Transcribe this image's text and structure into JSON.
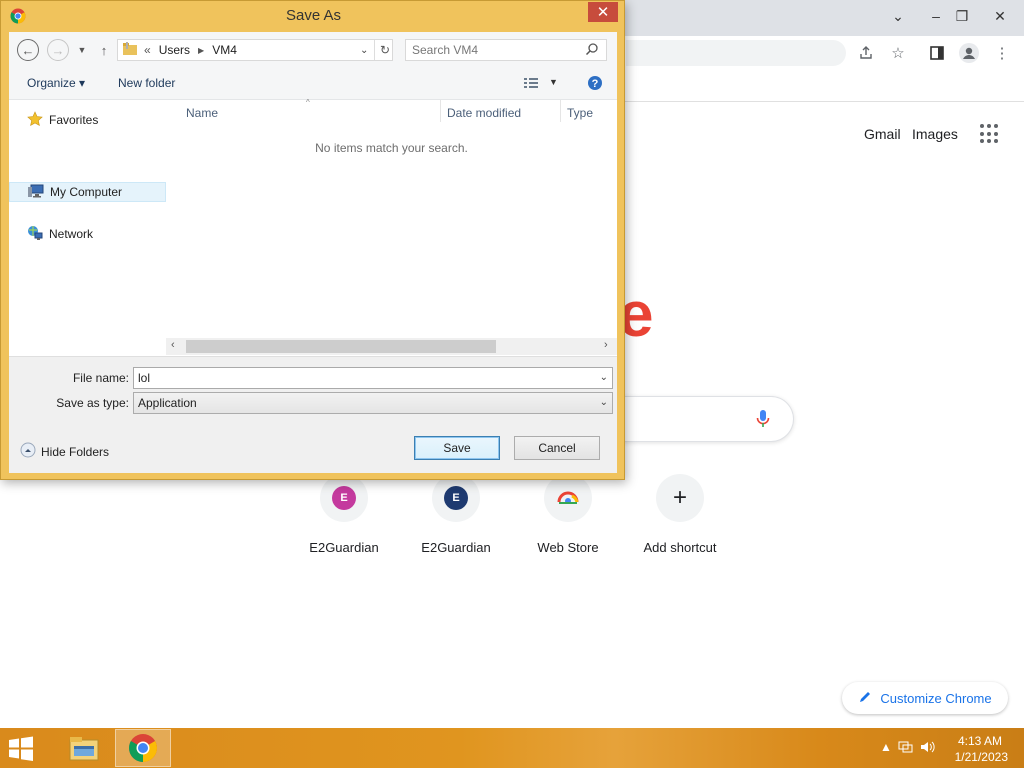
{
  "dialog": {
    "title": "Save As",
    "close_glyph": "✕",
    "address": {
      "prefix": "«",
      "path": [
        "Users",
        "VM4"
      ]
    },
    "search_placeholder": "Search VM4",
    "toolbar": {
      "organize": "Organize ▾",
      "new_folder": "New folder"
    },
    "nav": {
      "favorites": "Favorites",
      "my_computer": "My Computer",
      "network": "Network"
    },
    "columns": {
      "name": "Name",
      "date_modified": "Date modified",
      "type": "Type"
    },
    "empty_message": "No items match your search.",
    "file_name_label": "File name:",
    "file_name_value": "lol",
    "save_type_label": "Save as type:",
    "save_type_value": "Application",
    "hide_folders": "Hide Folders",
    "save_button": "Save",
    "cancel_button": "Cancel"
  },
  "browser": {
    "header_links": [
      "Gmail",
      "Images"
    ],
    "shortcuts": [
      {
        "label": "E2Guardian",
        "letter": "E",
        "color": "#c43a9e"
      },
      {
        "label": "E2Guardian",
        "letter": "E",
        "color": "#1e3a70"
      },
      {
        "label": "Web Store",
        "letter": "",
        "color": ""
      },
      {
        "label": "Add shortcut",
        "letter": "+",
        "color": ""
      }
    ],
    "customize_label": "Customize Chrome"
  },
  "taskbar": {
    "time": "4:13 AM",
    "date": "1/21/2023"
  },
  "colors": {
    "dialog_frame": "#f0c35c",
    "taskbar": "#d98a1c",
    "close_button": "#c74c3c",
    "link_blue": "#1a73e8"
  }
}
